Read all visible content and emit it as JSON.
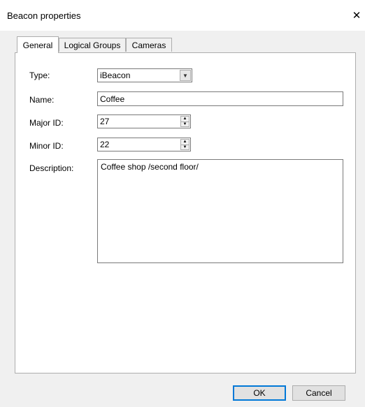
{
  "window": {
    "title": "Beacon properties",
    "close_glyph": "✕"
  },
  "tabs": [
    {
      "label": "General",
      "active": true
    },
    {
      "label": "Logical Groups",
      "active": false
    },
    {
      "label": "Cameras",
      "active": false
    }
  ],
  "form": {
    "type_label": "Type:",
    "type_value": "iBeacon",
    "name_label": "Name:",
    "name_value": "Coffee",
    "major_label": "Major ID:",
    "major_value": "27",
    "minor_label": "Minor ID:",
    "minor_value": "22",
    "description_label": "Description:",
    "description_value": "Coffee shop /second floor/"
  },
  "buttons": {
    "ok": "OK",
    "cancel": "Cancel"
  },
  "icons": {
    "close": "close-icon",
    "dropdown": "chevron-down-icon",
    "spin_up": "spin-up-icon",
    "spin_down": "spin-down-icon"
  },
  "colors": {
    "accent": "#0078d7",
    "dialog_bg": "#f0f0f0",
    "panel_bg": "#ffffff"
  }
}
